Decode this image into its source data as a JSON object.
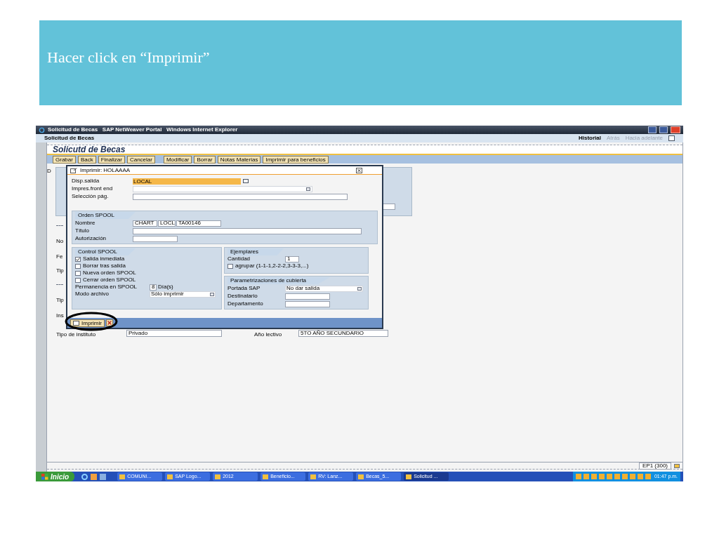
{
  "slide": {
    "title": "Hacer click en “Imprimir”"
  },
  "window": {
    "title": "Solicitud de Becas   SAP NetWeaver Portal   Windows Internet Explorer"
  },
  "portal": {
    "breadcrumb": "Solicitud de Becas",
    "history": "Historial",
    "back": "Atrás",
    "forward": "Hacia adelante"
  },
  "page": {
    "title": "Solicutd de Becas",
    "toolbar_groups": [
      [
        "Grabar",
        "Back",
        "Finalizar",
        "Cancelar"
      ],
      [
        "Modificar",
        "Borrar",
        "Notas Materias",
        "Imprimir para beneficios"
      ]
    ],
    "background_labels": [
      "D",
      "No",
      "Fe",
      "Tip",
      "Tip",
      "Ins"
    ],
    "institute": {
      "label": "Tipo de instituto",
      "value": "Privado"
    },
    "year": {
      "label": "Año lectivo",
      "value": "5TO AÑO SECUNDARIO"
    },
    "status": "EP1 (300)"
  },
  "dialog": {
    "title": "Imprimir: HOLAAAA",
    "fields": [
      {
        "label": "Disp.salida",
        "value": "LOCAL",
        "kind": "highlight"
      },
      {
        "label": "Impres.front end",
        "kind": "dropdown"
      },
      {
        "label": "Selección pág.",
        "kind": "text"
      }
    ],
    "orden_spool": {
      "title": "Orden SPOOL",
      "nombre_label": "Nombre",
      "nombre": [
        "CHART",
        "LOCL",
        "TA00146"
      ],
      "titulo_label": "Título",
      "autorizacion_label": "Autorización"
    },
    "control_spool": {
      "title": "Control SPOOL",
      "checkboxes": [
        {
          "label": "Salida inmediata",
          "checked": true
        },
        {
          "label": "Borrar tras salida",
          "checked": false
        },
        {
          "label": "Nueva orden SPOOL",
          "checked": false
        },
        {
          "label": "Cerrar orden SPOOL",
          "checked": false
        }
      ],
      "permanencia_label": "Permanencia en SPOOL",
      "permanencia": "8",
      "dias": "Día(s)",
      "modo_label": "Modo archivo",
      "modo": "Sólo imprimir"
    },
    "ejemplares": {
      "title": "Ejemplares",
      "cantidad_label": "Cantidad",
      "cantidad": "1",
      "agrupar": {
        "label": "agrupar (1-1-1,2-2-2,3-3-3,...)",
        "checked": false
      }
    },
    "cubierta": {
      "title": "Parametrizaciones de cubierta",
      "portada_label": "Portada SAP",
      "portada": "No dar salida",
      "destinatario_label": "Destinatario",
      "departamento_label": "Departamento"
    },
    "print_button": "Imprimir"
  },
  "taskbar": {
    "start": "Inicio",
    "items": [
      {
        "label": "COMUNI...",
        "selected": false
      },
      {
        "label": "SAP Logo...",
        "selected": false
      },
      {
        "label": "2012",
        "selected": false
      },
      {
        "label": "Beneficio...",
        "selected": false
      },
      {
        "label": "RV: Lanz...",
        "selected": false
      },
      {
        "label": "Becas_5...",
        "selected": false
      },
      {
        "label": "Solicitud ...",
        "selected": true
      }
    ],
    "clock": "01:47 p.m."
  }
}
